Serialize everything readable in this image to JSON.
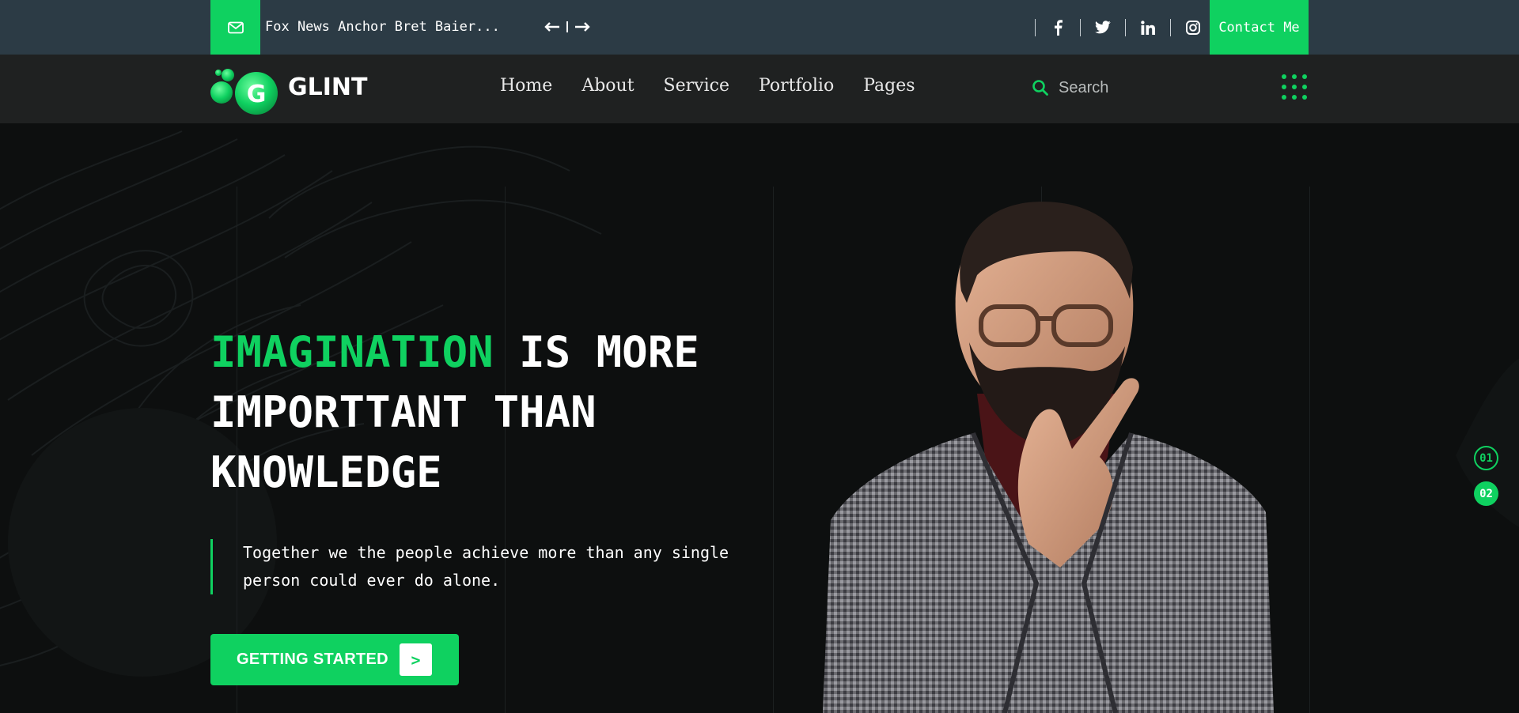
{
  "topbar": {
    "news_text": "Fox News Anchor Bret Baier...",
    "prev_icon": "arrow-left-icon",
    "next_icon": "arrow-right-icon",
    "mail_icon": "envelope-icon",
    "socials": [
      "facebook-icon",
      "twitter-icon",
      "linkedin-icon",
      "instagram-icon"
    ],
    "contact_label": "Contact Me"
  },
  "nav": {
    "logo_letter": "G",
    "logo_text": "GLINT",
    "items": [
      {
        "label": "Home"
      },
      {
        "label": "About"
      },
      {
        "label": "Service"
      },
      {
        "label": "Portfolio"
      },
      {
        "label": "Pages"
      }
    ],
    "search_placeholder": "Search",
    "menu_icon": "grid-dots-icon"
  },
  "hero": {
    "headline_accent": "IMAGINATION",
    "headline_rest_1": " IS MORE",
    "headline_line_2": "IMPORTTANT THAN",
    "headline_line_3": "KNOWLEDGE",
    "quote_line_1": "Together we the people achieve more than any single",
    "quote_line_2": "person could ever do alone.",
    "cta_label": "GETTING STARTED",
    "cta_arrow": ">",
    "slides": [
      {
        "label": "01",
        "active": false
      },
      {
        "label": "02",
        "active": true
      }
    ]
  },
  "colors": {
    "accent": "#0fd160",
    "topbar_bg": "#2c3b45",
    "nav_bg": "#1f2121",
    "hero_bg": "#0d0f0f"
  }
}
